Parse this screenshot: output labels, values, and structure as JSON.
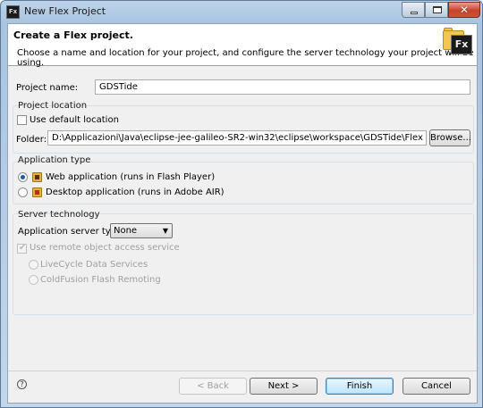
{
  "window": {
    "title": "New Flex Project",
    "icon_label": "Fx"
  },
  "header": {
    "title": "Create a Flex project.",
    "description": "Choose a name and location for your project, and configure the server technology your project will be using.",
    "badge": "Fx"
  },
  "project": {
    "name_label": "Project name:",
    "name_value": "GDSTide"
  },
  "location": {
    "group_title": "Project location",
    "use_default_label": "Use default location",
    "use_default_checked": false,
    "folder_label": "Folder:",
    "folder_value": "D:\\Applicazioni\\Java\\eclipse-jee-galileo-SR2-win32\\eclipse\\workspace\\GDSTide\\Flex",
    "browse_label": "Browse..."
  },
  "app_type": {
    "group_title": "Application type",
    "web_label": "Web application (runs in Flash Player)",
    "desktop_label": "Desktop application (runs in Adobe AIR)",
    "selected": "web"
  },
  "server": {
    "group_title": "Server technology",
    "server_type_label": "Application server type:",
    "server_type_value": "None",
    "remote_label": "Use remote object access service",
    "livecycle_label": "LiveCycle Data Services",
    "coldfusion_label": "ColdFusion Flash Remoting"
  },
  "footer": {
    "help_icon": "?",
    "back_label": "< Back",
    "next_label": "Next >",
    "finish_label": "Finish",
    "cancel_label": "Cancel"
  }
}
